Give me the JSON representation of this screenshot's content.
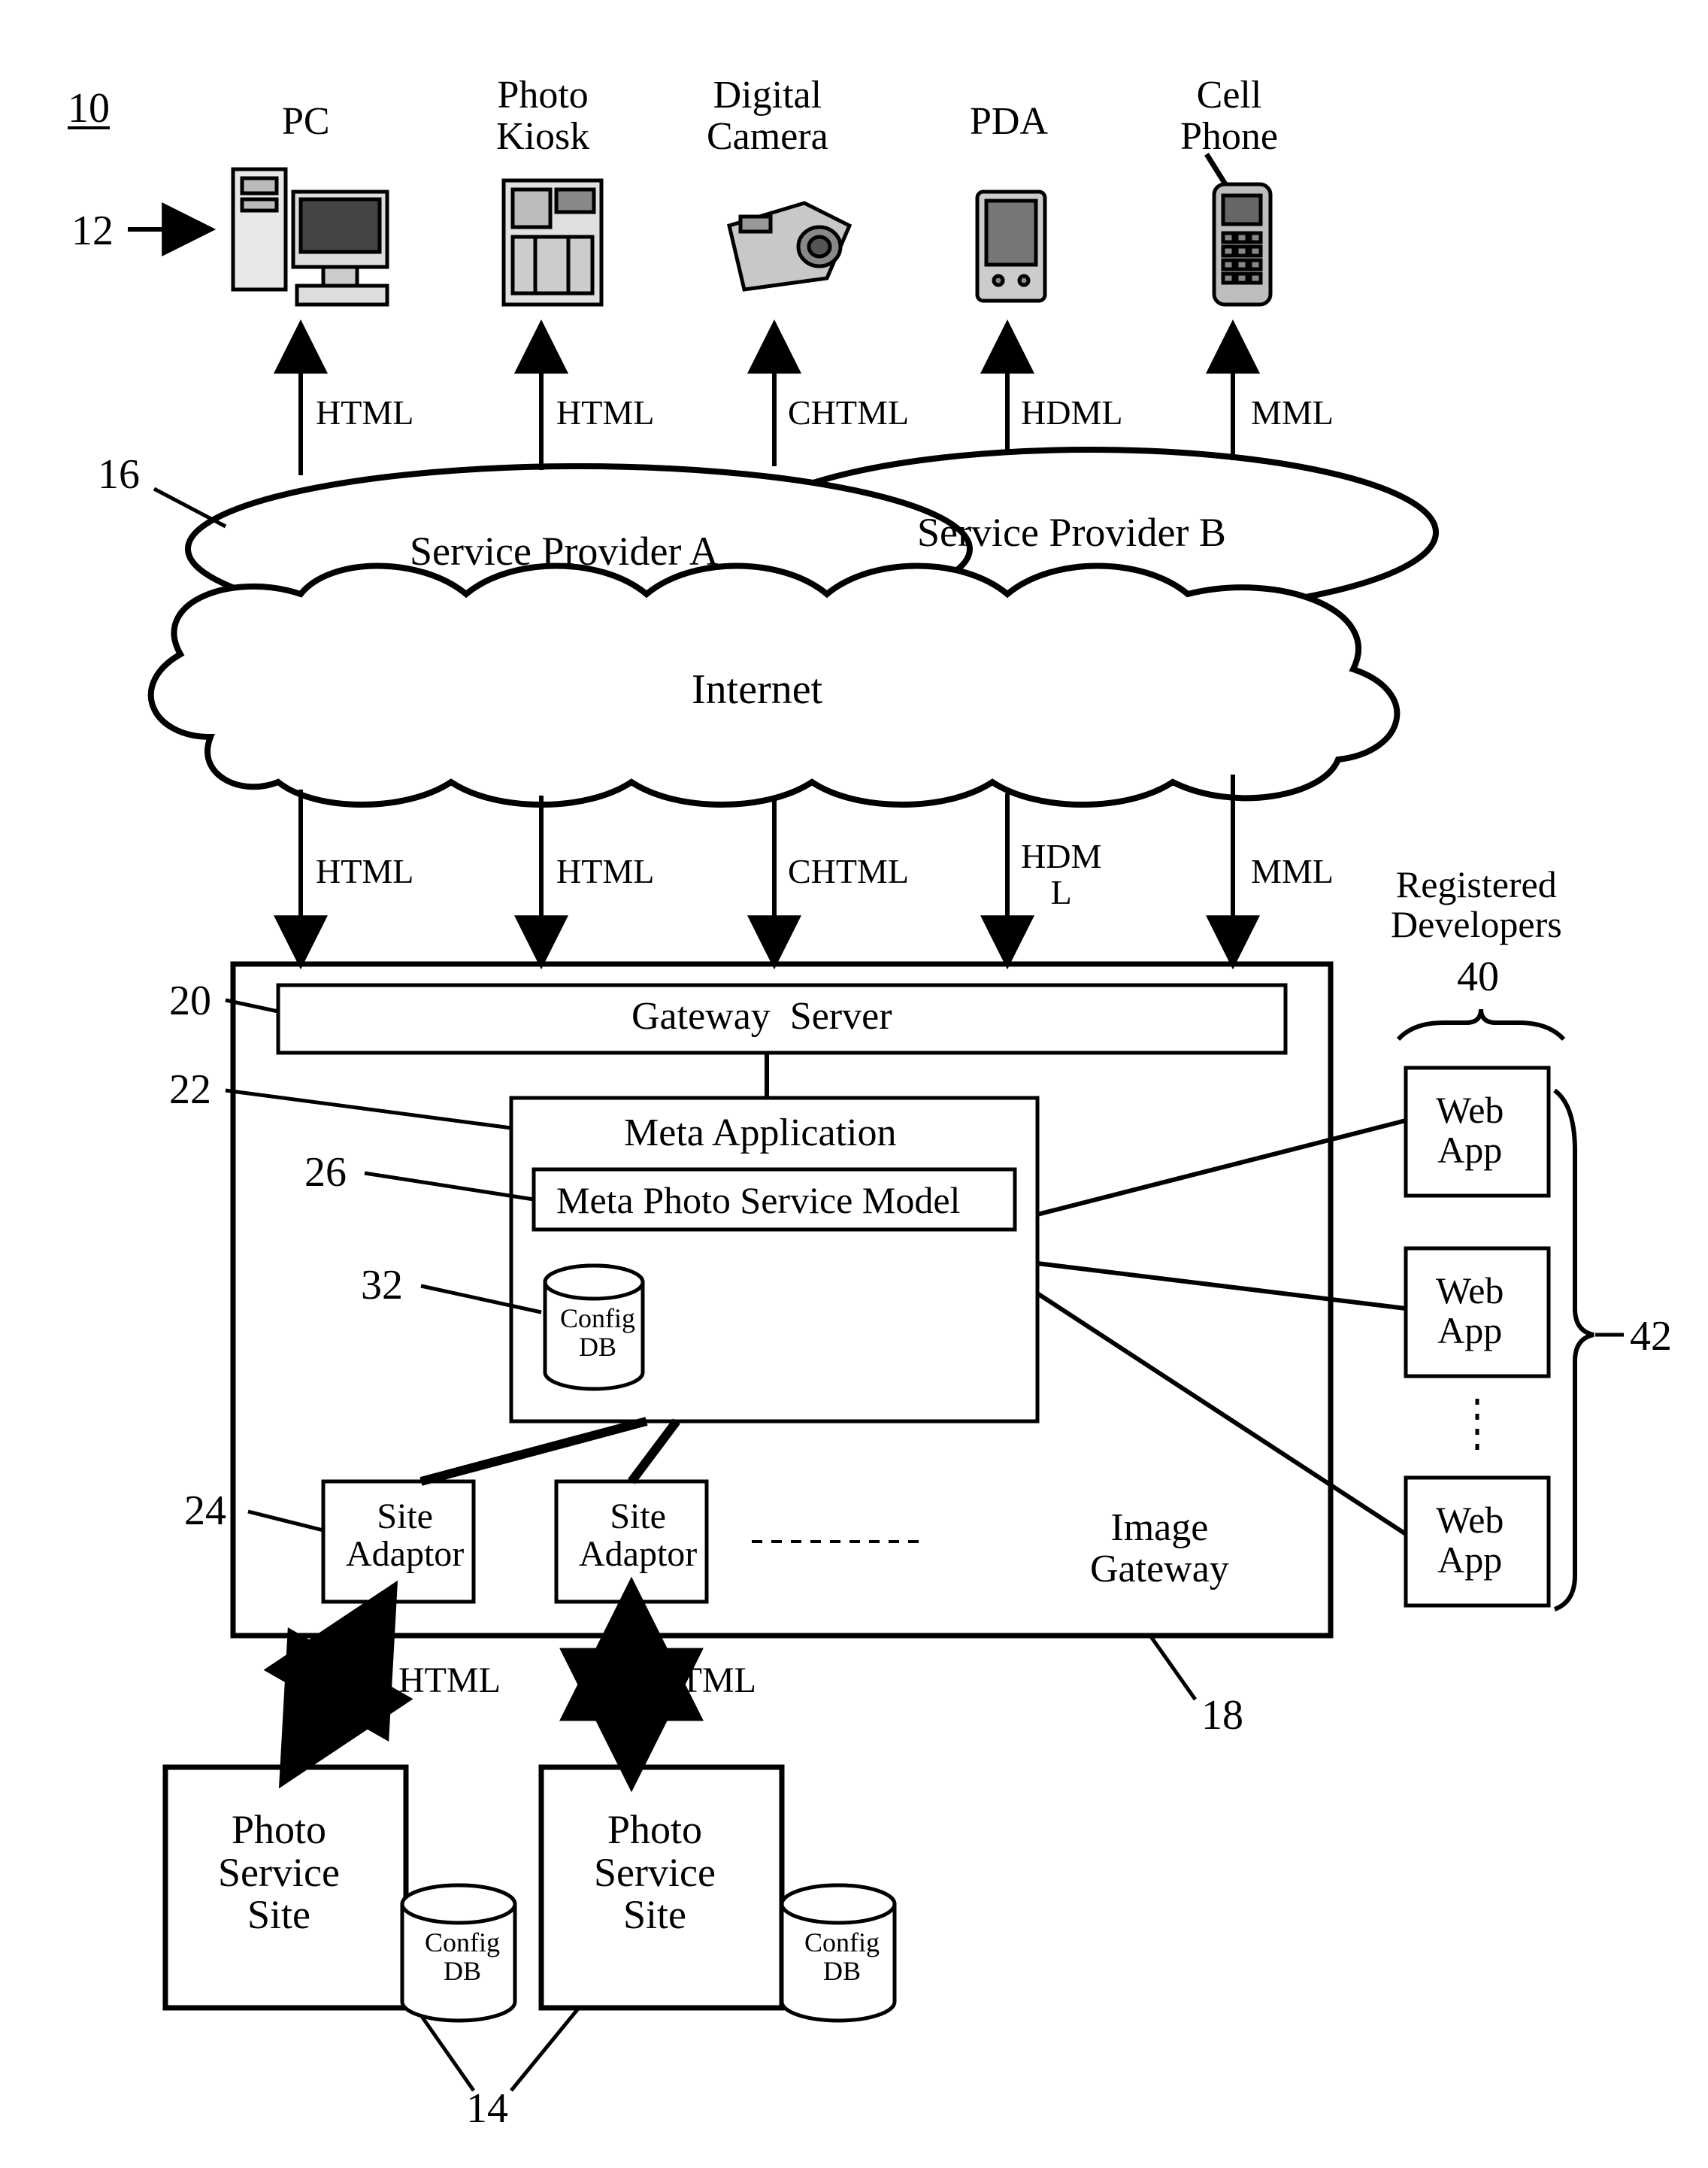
{
  "figure_number": "10",
  "callouts": {
    "n10": "10",
    "n12": "12",
    "n14": "14",
    "n16": "16",
    "n18": "18",
    "n20": "20",
    "n22": "22",
    "n24": "24",
    "n26": "26",
    "n32": "32",
    "n40": "40",
    "n42": "42"
  },
  "devices": {
    "pc": "PC",
    "kiosk": "Photo\nKiosk",
    "camera": "Digital\nCamera",
    "pda": "PDA",
    "phone": "Cell\nPhone"
  },
  "protocols_top": [
    "HTML",
    "HTML",
    "CHTML",
    "HDML",
    "MML"
  ],
  "protocols_mid": [
    "HTML",
    "HTML",
    "CHTML",
    "HDM\nL",
    "MML"
  ],
  "providers": {
    "a": "Service Provider A",
    "b": "Service Provider B"
  },
  "internet": "Internet",
  "gateway_server": "Gateway  Server",
  "meta_app": {
    "title": "Meta Application",
    "model": "Meta Photo Service Model",
    "config_db": "Config\nDB"
  },
  "site_adaptor": "Site\nAdaptor",
  "image_gateway": "Image\nGateway",
  "bottom_html": "HTML",
  "photo_site": "Photo\nService\nSite",
  "config_db": "Config\nDB",
  "registered_developers": "Registered\nDevelopers",
  "web_app": "Web\nApp"
}
